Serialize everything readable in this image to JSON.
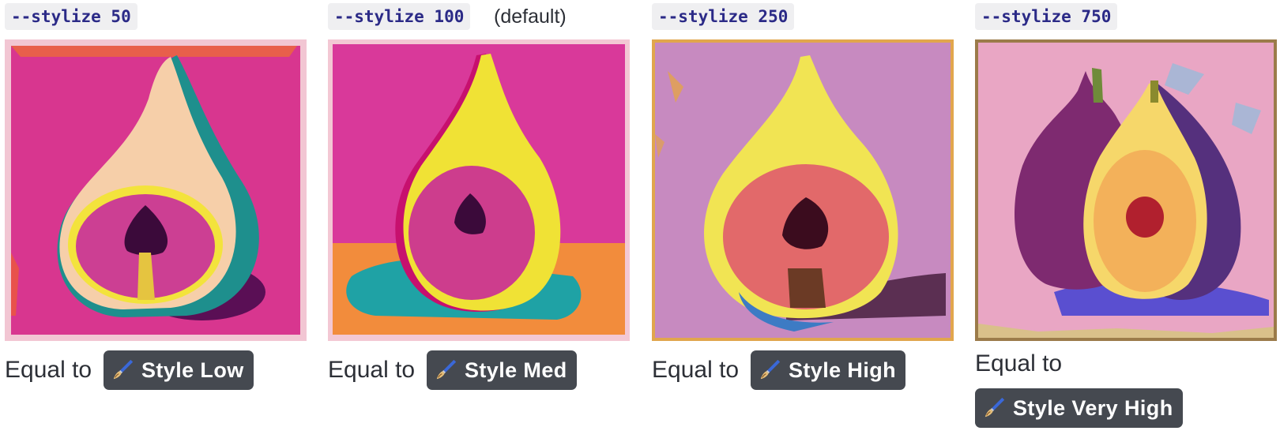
{
  "colors": {
    "code_bg": "#efeff1",
    "code_text": "#2b2a87",
    "badge_bg": "#454950",
    "badge_text": "#ffffff",
    "body_text": "#2c2f36"
  },
  "icons": {
    "badge": "paintbrush-icon"
  },
  "columns": [
    {
      "param": "--stylize 50",
      "note": "",
      "image_alt": "Pop-art fig half on magenta background",
      "equal_label": "Equal to",
      "badge": "Style Low"
    },
    {
      "param": "--stylize 100",
      "note": "(default)",
      "image_alt": "Pop-art fig half on magenta and orange background",
      "equal_label": "Equal to",
      "badge": "Style Med"
    },
    {
      "param": "--stylize 250",
      "note": "",
      "image_alt": "Painted fig half on lilac background",
      "equal_label": "Equal to",
      "badge": "Style High"
    },
    {
      "param": "--stylize 750",
      "note": "",
      "image_alt": "Painted whole fig and fig half on pink weathered background",
      "equal_label": "Equal to",
      "badge": "Style Very High"
    }
  ]
}
